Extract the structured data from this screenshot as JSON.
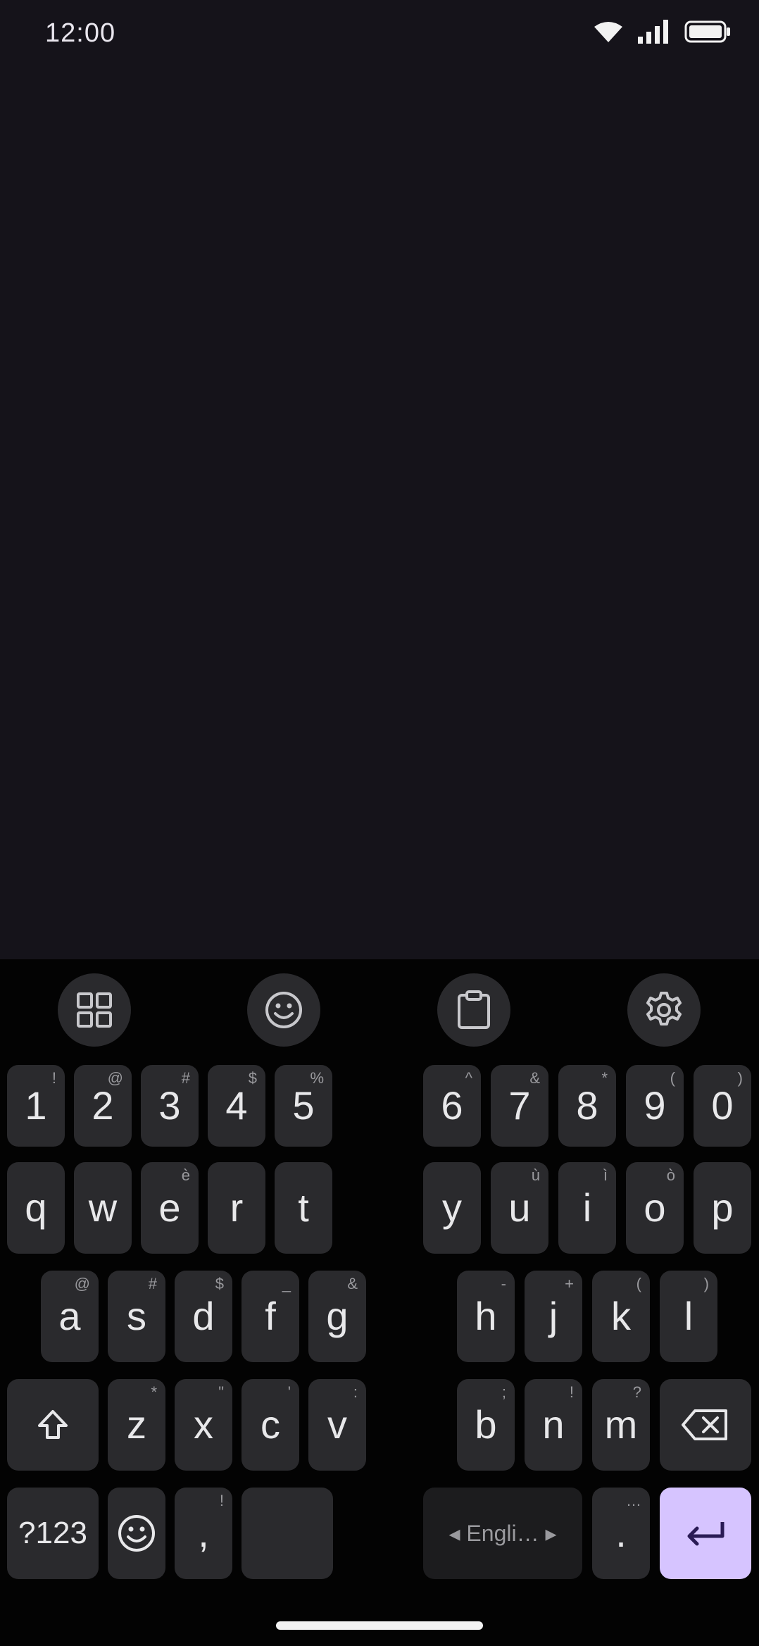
{
  "status_bar": {
    "time": "12:00"
  },
  "keyboard": {
    "toolbar": [
      {
        "name": "apps-grid-icon"
      },
      {
        "name": "emoji-icon"
      },
      {
        "name": "clipboard-icon"
      },
      {
        "name": "settings-icon"
      }
    ],
    "rows": [
      [
        {
          "label": "1",
          "hint": "!"
        },
        {
          "label": "2",
          "hint": "@"
        },
        {
          "label": "3",
          "hint": "#"
        },
        {
          "label": "4",
          "hint": "$"
        },
        {
          "label": "5",
          "hint": "%"
        },
        {
          "label": "6",
          "hint": "^"
        },
        {
          "label": "7",
          "hint": "&"
        },
        {
          "label": "8",
          "hint": "*"
        },
        {
          "label": "9",
          "hint": "("
        },
        {
          "label": "0",
          "hint": ")"
        }
      ],
      [
        {
          "label": "q",
          "hint": ""
        },
        {
          "label": "w",
          "hint": ""
        },
        {
          "label": "e",
          "hint": "è"
        },
        {
          "label": "r",
          "hint": ""
        },
        {
          "label": "t",
          "hint": ""
        },
        {
          "label": "y",
          "hint": ""
        },
        {
          "label": "u",
          "hint": "ù"
        },
        {
          "label": "i",
          "hint": "ì"
        },
        {
          "label": "o",
          "hint": "ò"
        },
        {
          "label": "p",
          "hint": ""
        }
      ],
      [
        {
          "label": "a",
          "hint": "@"
        },
        {
          "label": "s",
          "hint": "#"
        },
        {
          "label": "d",
          "hint": "$"
        },
        {
          "label": "f",
          "hint": "_"
        },
        {
          "label": "g",
          "hint": "&"
        },
        {
          "label": "h",
          "hint": "-"
        },
        {
          "label": "j",
          "hint": "+"
        },
        {
          "label": "k",
          "hint": "("
        },
        {
          "label": "l",
          "hint": ")"
        }
      ],
      [
        {
          "label": "z",
          "hint": "*"
        },
        {
          "label": "x",
          "hint": "\""
        },
        {
          "label": "c",
          "hint": "'"
        },
        {
          "label": "v",
          "hint": ":"
        },
        {
          "label": "b",
          "hint": ";"
        },
        {
          "label": "n",
          "hint": "!"
        },
        {
          "label": "m",
          "hint": "?"
        }
      ]
    ],
    "bottom": {
      "symbols_label": "?123",
      "comma_label": ",",
      "comma_hint": "!",
      "space_label": "◂  Engli…  ▸",
      "period_label": ".",
      "period_hint": "…"
    },
    "enter_color": "#d6c4ff"
  }
}
